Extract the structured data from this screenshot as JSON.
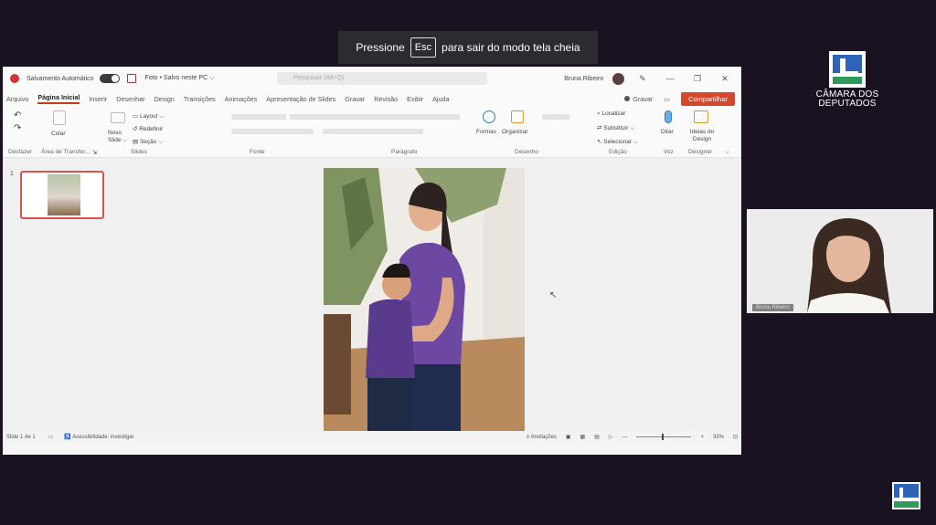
{
  "fullscreen_banner": {
    "prefix": "Pressione",
    "key": "Esc",
    "suffix": "para sair do modo tela cheia"
  },
  "titlebar": {
    "autosave_label": "Salvamento Automático",
    "file_name": "Foto • Salvo neste PC ⌵",
    "search_placeholder": "Pesquisar (Alt+Q)",
    "user_name": "Bruna Ribeiro",
    "minimize": "—",
    "maximize": "❐",
    "close": "✕"
  },
  "tabs": [
    "Arquivo",
    "Página Inicial",
    "Inserir",
    "Desenhar",
    "Design",
    "Transições",
    "Animações",
    "Apresentação de Slides",
    "Gravar",
    "Revisão",
    "Exibir",
    "Ajuda"
  ],
  "ribbon": {
    "record": "Gravar",
    "share": "Compartilhar",
    "paste": "Colar",
    "new_slide": "Novo Slide ⌵",
    "layout": "Layout ⌵",
    "reset": "Redefinir",
    "section": "Seção ⌵",
    "shapes": "Formas",
    "arrange": "Organizar",
    "find": "Localizar",
    "replace": "Substituir ⌵",
    "select": "Selecionar ⌵",
    "dictate": "Ditar",
    "design_ideas": "Ideias do Design",
    "groups": {
      "undo": "Desfazer",
      "clipboard": "Área de Transfer...",
      "slides": "Slides",
      "font": "Fonte",
      "paragraph": "Parágrafo",
      "drawing": "Desenho",
      "editing": "Edição",
      "voice": "Voz",
      "designer": "Designer"
    }
  },
  "thumbnail": {
    "number": "1"
  },
  "statusbar": {
    "slide_info": "Slide 1 de 1",
    "accessibility": "Acessibilidade: investigar",
    "notes": "Anotações",
    "zoom": "33%"
  },
  "logo": {
    "line1": "CÂMARA DOS",
    "line2": "DEPUTADOS"
  },
  "camera": {
    "name": "Bruna Ribeiro"
  },
  "colors": {
    "accent": "#c43e1c",
    "share": "#d5482b",
    "thumb_border": "#d9534f"
  }
}
